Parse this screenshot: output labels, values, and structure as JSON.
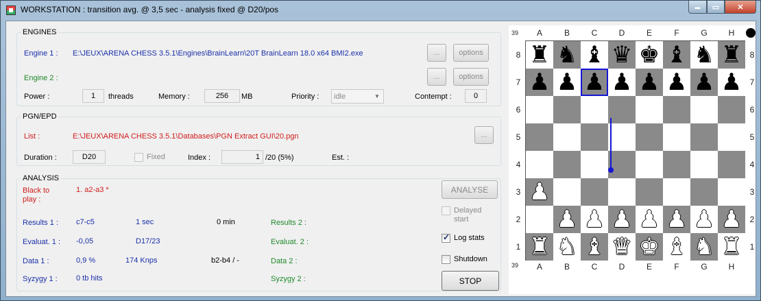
{
  "window": {
    "title": "WORKSTATION : transition avg. @ 3,5 sec - analysis fixed @ D20/pos",
    "min_glyph": "▬",
    "max_glyph": "▭",
    "close_glyph": "✕"
  },
  "engines": {
    "group_label": "ENGINES",
    "engine1_label": "Engine 1 :",
    "engine1_path": "E:\\JEUX\\ARENA CHESS 3.5.1\\Engines\\BrainLearn\\20T BrainLearn 18.0 x64 BMI2.exe",
    "engine2_label": "Engine 2 :",
    "browse_label": "...",
    "options_label": "options",
    "power_label": "Power :",
    "power_value": "1",
    "threads_label": "threads",
    "memory_label": "Memory :",
    "memory_value": "256",
    "memory_unit": "MB",
    "priority_label": "Priority :",
    "priority_value": "idle",
    "contempt_label": "Contempt :",
    "contempt_value": "0"
  },
  "pgn": {
    "group_label": "PGN/EPD",
    "list_label": "List :",
    "list_path": "E:\\JEUX\\ARENA CHESS 3.5.1\\Databases\\PGN Extract GUI\\20.pgn",
    "browse_label": "...",
    "duration_label": "Duration :",
    "duration_value": "D20",
    "fixed_label": "Fixed",
    "index_label": "Index :",
    "index_value": "1",
    "index_total": "/20 (5%)",
    "est_label": "Est. :"
  },
  "analysis": {
    "group_label": "ANALYSIS",
    "side_to_play": "Black to play :",
    "last_move": "1. a2-a3 *",
    "results1_label": "Results 1 :",
    "results1_move": "c7-c5",
    "results1_time": "1 sec",
    "elapsed": "0 min",
    "results2_label": "Results 2 :",
    "eval1_label": "Evaluat. 1 :",
    "eval1_value": "-0,05",
    "eval1_depth": "D17/23",
    "eval2_label": "Evaluat. 2 :",
    "data1_label": "Data 1 :",
    "data1_pct": "0,9 %",
    "data1_speed": "174 Knps",
    "data1_move": "b2-b4 / -",
    "data2_label": "Data 2 :",
    "syzygy1_label": "Syzygy 1 :",
    "syzygy1_value": "0 tb hits",
    "syzygy2_label": "Syzygy 2 :",
    "analyse_button": "ANALYSE",
    "delayed_start": "Delayed start",
    "log_stats": "Log stats",
    "shutdown": "Shutdown",
    "stop_button": "STOP"
  },
  "board": {
    "files": [
      "A",
      "B",
      "C",
      "D",
      "E",
      "F",
      "G",
      "H"
    ],
    "ranks": [
      "8",
      "7",
      "6",
      "5",
      "4",
      "3",
      "2",
      "1"
    ],
    "move_count": "39",
    "squares": [
      [
        "♜",
        "♞",
        "♝",
        "♛",
        "♚",
        "♝",
        "♞",
        "♜"
      ],
      [
        "♟",
        "♟",
        "♟",
        "♟",
        "♟",
        "♟",
        "♟",
        "♟"
      ],
      [
        "",
        "",
        "",
        "",
        "",
        "",
        "",
        ""
      ],
      [
        "",
        "",
        "",
        "",
        "",
        "",
        "",
        ""
      ],
      [
        "",
        "",
        "",
        "",
        "",
        "",
        "",
        ""
      ],
      [
        "♙",
        "",
        "",
        "",
        "",
        "",
        "",
        ""
      ],
      [
        "",
        "♙",
        "♙",
        "♙",
        "♙",
        "♙",
        "♙",
        "♙"
      ],
      [
        "♖",
        "♘",
        "♗",
        "♕",
        "♔",
        "♗",
        "♘",
        "♖"
      ]
    ],
    "colors": {
      "light": "#ffffff",
      "dark": "#8a8a8a",
      "highlight": "#1515d6"
    }
  }
}
